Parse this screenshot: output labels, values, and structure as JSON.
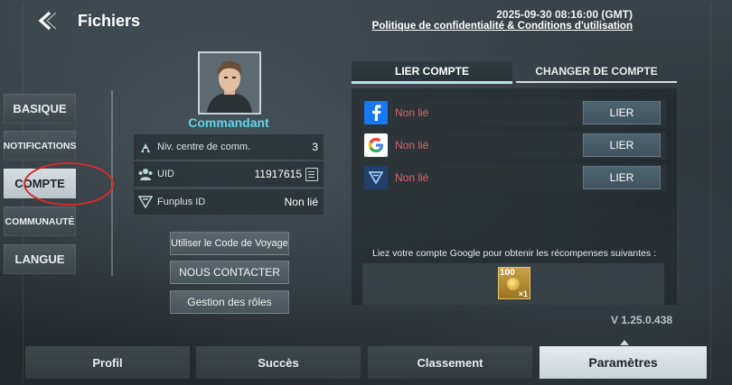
{
  "header": {
    "title": "Fichiers",
    "datetime": "2025-09-30 08:16:00 (GMT)",
    "policy_link": "Politique de confidentialité & Conditions d'utilisation"
  },
  "left_tabs": [
    {
      "label": "BASIQUE",
      "active": false
    },
    {
      "label": "NOTIFICATIONS",
      "active": false
    },
    {
      "label": "COMPTE",
      "active": true
    },
    {
      "label": "COMMUNAUTÉ",
      "active": false
    },
    {
      "label": "LANGUE",
      "active": false
    }
  ],
  "profile": {
    "name": "Commandant",
    "rows": [
      {
        "label": "Niv. centre de comm.",
        "value": "3",
        "icon": "command-center-icon"
      },
      {
        "label": "UID",
        "value": "11917615",
        "icon": "group-icon"
      },
      {
        "label": "Funplus ID",
        "value": "Non lié",
        "icon": "funplus-icon"
      }
    ],
    "buttons": {
      "voyage": "Utiliser le Code de Voyage",
      "contact": "NOUS CONTACTER",
      "roles": "Gestion des rôles"
    }
  },
  "account": {
    "tabs": {
      "link": "LIER COMPTE",
      "switch": "CHANGER DE COMPTE"
    },
    "providers": [
      {
        "name": "facebook",
        "status": "Non lié",
        "button": "LIER",
        "color": "#1877f2"
      },
      {
        "name": "google",
        "status": "Non lié",
        "button": "LIER",
        "color": "#ffffff"
      },
      {
        "name": "funplus",
        "status": "Non lié",
        "button": "LIER",
        "color": "#2a4d7a"
      }
    ],
    "reward_text": "Liez votre compte Google pour obtenir les récompenses suivantes :",
    "reward": {
      "amount": "100",
      "count": "×1"
    }
  },
  "version": "V 1.25.0.438",
  "bottom_tabs": [
    {
      "label": "Profil",
      "active": false
    },
    {
      "label": "Succès",
      "active": false
    },
    {
      "label": "Classement",
      "active": false
    },
    {
      "label": "Paramètres",
      "active": true
    }
  ],
  "colors": {
    "accent_cyan": "#5fd6e8",
    "status_red": "#e1606a",
    "highlight_ring": "#d52a2a"
  }
}
